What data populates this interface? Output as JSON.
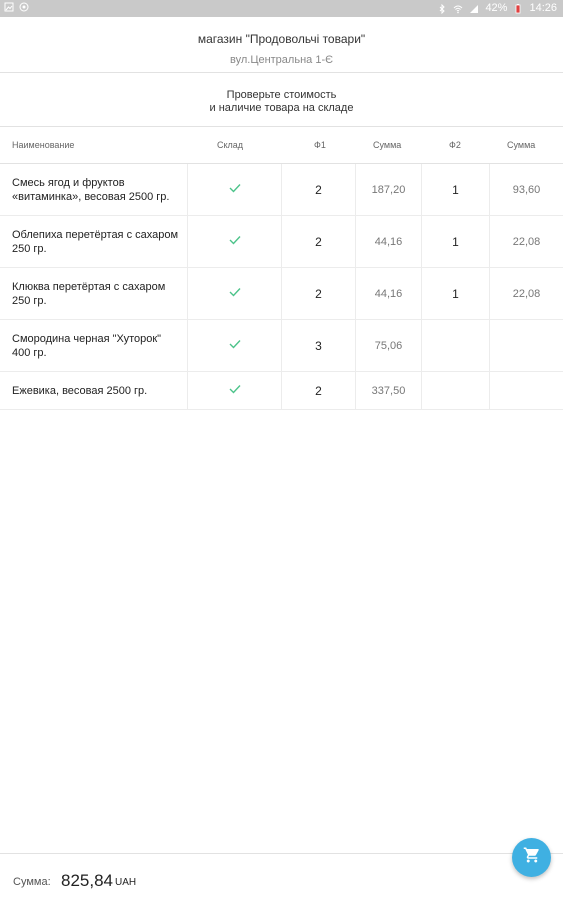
{
  "status_bar": {
    "battery": "42%",
    "time": "14:26",
    "icons": [
      "gallery-icon",
      "android-icon",
      "bluetooth-icon",
      "wifi-icon",
      "signal-icon",
      "battery-icon"
    ]
  },
  "header": {
    "store_name": "магазин \"Продовольчі товари\"",
    "address": "вул.Центральна 1-Є"
  },
  "notice": {
    "line1": "Проверьте стоимость",
    "line2": "и наличие товара на складе"
  },
  "table": {
    "columns": [
      "Наименование",
      "Склад",
      "Ф1",
      "Сумма",
      "Ф2",
      "Сумма"
    ],
    "rows": [
      {
        "name": "Смесь ягод и фруктов «витаминка», весовая 2500 гр.",
        "in_stock": true,
        "f1": "2",
        "sum1": "187,20",
        "f2": "1",
        "sum2": "93,60"
      },
      {
        "name": "Облепиха перетёртая с сахаром 250 гр.",
        "in_stock": true,
        "f1": "2",
        "sum1": "44,16",
        "f2": "1",
        "sum2": "22,08"
      },
      {
        "name": "Клюква перетёртая с сахаром 250 гр.",
        "in_stock": true,
        "f1": "2",
        "sum1": "44,16",
        "f2": "1",
        "sum2": "22,08"
      },
      {
        "name": "Смородина черная \"Хуторок\" 400 гр.",
        "in_stock": true,
        "f1": "3",
        "sum1": "75,06",
        "f2": "",
        "sum2": ""
      },
      {
        "name": "Ежевика, весовая 2500 гр.",
        "in_stock": true,
        "f1": "2",
        "sum1": "337,50",
        "f2": "",
        "sum2": ""
      }
    ]
  },
  "footer": {
    "sum_label": "Сумма:",
    "sum_value": "825,84",
    "currency": "UAH"
  },
  "colors": {
    "accent": "#3fb0e2",
    "check": "#4cc38a",
    "status_bar": "#c9c9c9"
  },
  "fab": {
    "icon": "cart-icon"
  }
}
